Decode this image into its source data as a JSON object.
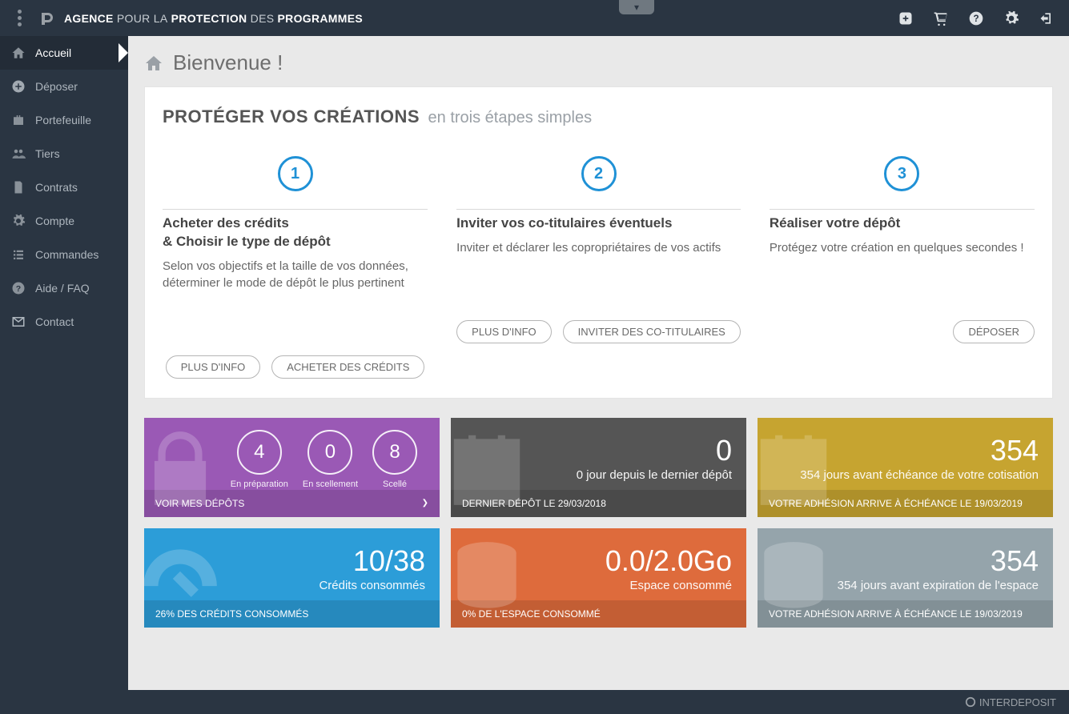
{
  "brand": {
    "p1": "AGENCE",
    "p2": "POUR LA",
    "p3": "PROTECTION",
    "p4": "DES",
    "p5": "PROGRAMMES"
  },
  "sidebar": [
    {
      "label": "Accueil",
      "active": true,
      "name": "sidebar-item-accueil",
      "icon": "home"
    },
    {
      "label": "Déposer",
      "name": "sidebar-item-deposer",
      "icon": "plus"
    },
    {
      "label": "Portefeuille",
      "name": "sidebar-item-portefeuille",
      "icon": "briefcase"
    },
    {
      "label": "Tiers",
      "name": "sidebar-item-tiers",
      "icon": "users"
    },
    {
      "label": "Contrats",
      "name": "sidebar-item-contrats",
      "icon": "file"
    },
    {
      "label": "Compte",
      "name": "sidebar-item-compte",
      "icon": "gear"
    },
    {
      "label": "Commandes",
      "name": "sidebar-item-commandes",
      "icon": "list"
    },
    {
      "label": "Aide / FAQ",
      "name": "sidebar-item-aide",
      "icon": "help"
    },
    {
      "label": "Contact",
      "name": "sidebar-item-contact",
      "icon": "mail"
    }
  ],
  "page": {
    "title": "Bienvenue !"
  },
  "protect": {
    "heading": "PROTÉGER VOS CRÉATIONS",
    "subheading": "en trois étapes simples",
    "steps": [
      {
        "num": "1",
        "title": "Acheter des crédits\n& Choisir le type de dépôt",
        "desc": "Selon vos objectifs et la taille de vos données, déterminer le mode de dépôt le plus pertinent",
        "actions": [
          "PLUS D'INFO",
          "ACHETER DES CRÉDITS"
        ]
      },
      {
        "num": "2",
        "title": "Inviter vos co-titulaires éventuels",
        "desc": "Inviter et déclarer les copropriétaires de vos actifs",
        "actions": [
          "PLUS D'INFO",
          "INVITER DES CO-TITULAIRES"
        ]
      },
      {
        "num": "3",
        "title": "Réaliser votre dépôt",
        "desc": "Protégez votre création en quelques secondes !",
        "actions": [
          "DÉPOSER"
        ]
      }
    ]
  },
  "tiles": {
    "depots": {
      "prep": "4",
      "scell": "0",
      "selle": "8",
      "l_prep": "En préparation",
      "l_scell": "En scellement",
      "l_selle": "Scellé",
      "footer": "VOIR MES DÉPÔTS"
    },
    "last": {
      "big": "0",
      "sub": "0 jour depuis le dernier dépôt",
      "footer": "DERNIER DÉPÔT LE 29/03/2018"
    },
    "cotis": {
      "big": "354",
      "sub": "354 jours avant échéance de votre cotisation",
      "footer": "VOTRE ADHÉSION ARRIVE À ÉCHÉANCE LE 19/03/2019"
    },
    "credits": {
      "big": "10/38",
      "sub": "Crédits consommés",
      "footer": "26% DES CRÉDITS CONSOMMÉS"
    },
    "space": {
      "big": "0.0/2.0Go",
      "sub": "Espace consommé",
      "footer": "0% DE L'ESPACE CONSOMMÉ"
    },
    "expir": {
      "big": "354",
      "sub": "354 jours avant expiration de l'espace",
      "footer": "VOTRE ADHÉSION ARRIVE À ÉCHÉANCE LE 19/03/2019"
    }
  },
  "footer": {
    "brand": "INTERDEPOSIT"
  }
}
